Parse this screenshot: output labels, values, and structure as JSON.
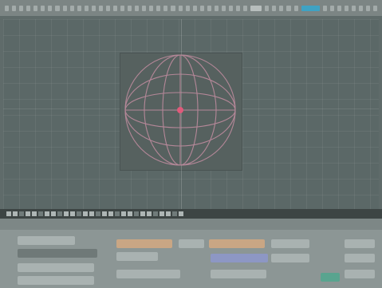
{
  "menubar": {
    "slot_count": 52,
    "highlight_index": 40
  },
  "viewport": {
    "object": "sphere",
    "object_color": "#c58ea2",
    "center_color": "#e05a7a"
  },
  "timeline": {
    "tick_count": 28
  },
  "panel": {
    "buttons": []
  },
  "colors": {
    "background": "#5f6b6a",
    "accent": "#3fa2c3",
    "button_orange": "#c9a684",
    "button_blue": "#8d97c4"
  }
}
